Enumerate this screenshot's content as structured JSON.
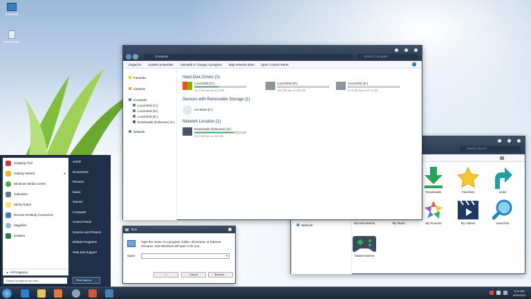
{
  "desktop": {
    "icons": [
      {
        "label": "Computer"
      },
      {
        "label": "Recycle Bin"
      }
    ]
  },
  "explorer": {
    "address": "Computer",
    "search_placeholder": "Search Computer",
    "commands": [
      "Organize",
      "System properties",
      "Uninstall or change a program",
      "Map network drive",
      "Open Control Panel"
    ],
    "sidebar": {
      "favorites": "Favorites",
      "libraries": "Libraries",
      "computer": "Computer",
      "drives": [
        "Local Disk (C:)",
        "Local Disk (D:)",
        "Local Disk (E:)",
        "Downloads (\\\\Vboxsvr) (Z:)"
      ],
      "network": "Network"
    },
    "hdd_header": "Hard Disk Drives (3)",
    "hdds": [
      {
        "name": "Local Disk (C:)",
        "free": "16.2 GB free of 30.2 GB",
        "used": 0.46
      },
      {
        "name": "Local Disk (D:)",
        "free": "102 GB free of 102 GB",
        "used": 0.0
      },
      {
        "name": "Local Disk (E:)",
        "free": "97.5 GB free of 97.6 GB",
        "used": 0.0
      }
    ],
    "removable_header": "Devices with Removable Storage (1)",
    "cd": {
      "name": "CD Drive (F:)"
    },
    "network_header": "Network Location (1)",
    "netdrive": {
      "name": "Downloads (\\\\Vboxsvr) (Z:)",
      "free": "23.0 GB free of 100 GB",
      "used": 0.77
    }
  },
  "libraries_window": {
    "search_placeholder": "Search search",
    "sidebar_network": "Network",
    "items": [
      {
        "label": "Downloads",
        "icon": "download-icon"
      },
      {
        "label": "Favorites",
        "icon": "star-icon"
      },
      {
        "label": "Links",
        "icon": "link-icon"
      },
      {
        "label": "My Documents",
        "icon": "documents-icon"
      },
      {
        "label": "My Music",
        "icon": "music-icon"
      },
      {
        "label": "My Pictures",
        "icon": "pictures-icon"
      },
      {
        "label": "My Videos",
        "icon": "videos-icon"
      },
      {
        "label": "Searches",
        "icon": "search-icon"
      },
      {
        "label": "Saved Games",
        "icon": "gamepad-icon"
      }
    ]
  },
  "start_menu": {
    "programs": [
      "Snipping Tool",
      "Getting Started",
      "Windows Media Center",
      "Calculator",
      "Sticky Notes",
      "Remote Desktop Connection",
      "Magnifier",
      "Solitaire"
    ],
    "all_programs": "All Programs",
    "search_placeholder": "Search programs and files",
    "right": [
      "vmeth",
      "Documents",
      "Pictures",
      "Music",
      "Games",
      "Computer",
      "Control Panel",
      "Devices and Printers",
      "Default Programs",
      "Help and Support"
    ],
    "shutdown": "Shut down"
  },
  "run_dialog": {
    "title": "Run",
    "description": "Type the name of a program, folder, document, or Internet resource, and Windows will open it for you.",
    "open_label": "Open:",
    "ok": "OK",
    "cancel": "Cancel",
    "browse": "Browse..."
  },
  "taskbar": {
    "time": "5:11 AM",
    "date": "6/16/2022"
  },
  "colors": {
    "accent": "#2c3d52",
    "progress": "#22b24c",
    "star": "#f6c531"
  }
}
